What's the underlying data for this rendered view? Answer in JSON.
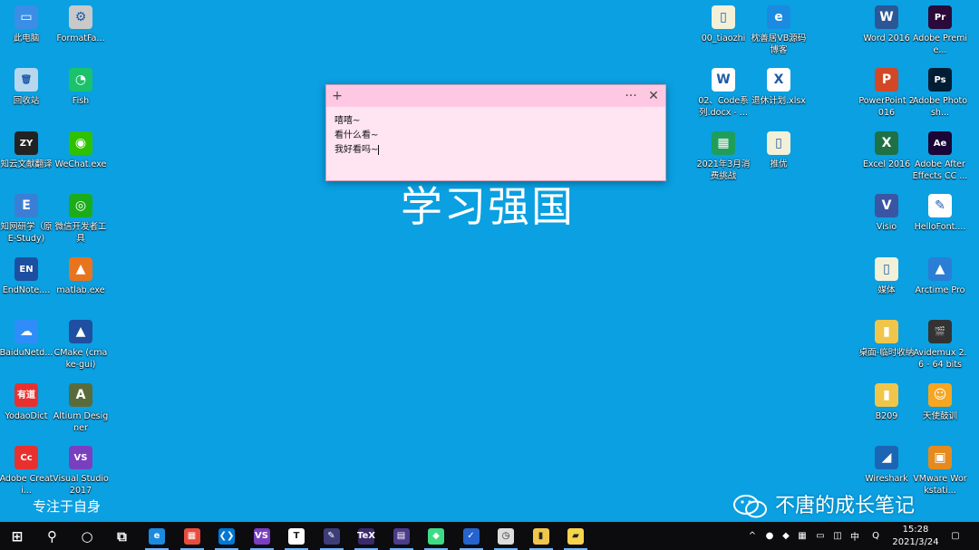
{
  "desktop": {
    "icons_left": [
      {
        "label": "此电脑",
        "icon": "computer-icon",
        "color": "#3a8ee6",
        "sym": "▭"
      },
      {
        "label": "FormatFa...",
        "icon": "formatfactory-icon",
        "color": "#c9c9c9",
        "sym": "⚙"
      },
      {
        "label": "回收站",
        "icon": "recycle-bin-icon",
        "color": "#b6d7ee",
        "sym": "🗑"
      },
      {
        "label": "Fish",
        "icon": "fish-icon",
        "color": "#19c26b",
        "sym": "◔"
      },
      {
        "label": "知云文献翻译",
        "icon": "zhiyun-icon",
        "color": "#222222",
        "sym": "ZY"
      },
      {
        "label": "WeChat.exe",
        "icon": "wechat-icon",
        "color": "#2dc100",
        "sym": "◉"
      },
      {
        "label": "知网研学（原E-Study)",
        "icon": "cnki-icon",
        "color": "#3a7fd5",
        "sym": "E"
      },
      {
        "label": "微信开发者工具",
        "icon": "wechat-devtools-icon",
        "color": "#1aad19",
        "sym": "◎"
      },
      {
        "label": "EndNote....",
        "icon": "endnote-icon",
        "color": "#1d4fa1",
        "sym": "EN"
      },
      {
        "label": "matlab.exe",
        "icon": "matlab-icon",
        "color": "#e8741e",
        "sym": "▲"
      },
      {
        "label": "BaiduNetd...",
        "icon": "baidu-netdisk-icon",
        "color": "#2f8dfa",
        "sym": "☁"
      },
      {
        "label": "CMake (cmake-gui)",
        "icon": "cmake-icon",
        "color": "#1e4fa0",
        "sym": "▲"
      },
      {
        "label": "YodaoDict",
        "icon": "youdao-icon",
        "color": "#e8312f",
        "sym": "有道"
      },
      {
        "label": "Altium Designer",
        "icon": "altium-icon",
        "color": "#5a6b3a",
        "sym": "A"
      },
      {
        "label": "Adobe Creati...",
        "icon": "creative-cloud-icon",
        "color": "#e8312f",
        "sym": "Cc"
      },
      {
        "label": "Visual Studio 2017",
        "icon": "visual-studio-icon",
        "color": "#7a3fbf",
        "sym": "VS"
      }
    ],
    "icons_right": [
      {
        "label": "00_tiaozhi",
        "icon": "file-icon",
        "color": "#f3f0d8",
        "sym": "▯"
      },
      {
        "label": "枕善居VB源码博客",
        "icon": "edge-icon",
        "color": "#1a8be0",
        "sym": "e"
      },
      {
        "label": "Word 2016",
        "icon": "word-icon",
        "color": "#2b5797",
        "sym": "W"
      },
      {
        "label": "Adobe Premie...",
        "icon": "premiere-icon",
        "color": "#2a0a3a",
        "sym": "Pr"
      },
      {
        "label": "02、Code系列.docx - ...",
        "icon": "docx-icon",
        "color": "#ffffff",
        "sym": "W"
      },
      {
        "label": "退休计划.xlsx",
        "icon": "xlsx-icon",
        "color": "#ffffff",
        "sym": "X"
      },
      {
        "label": "PowerPoint 2016",
        "icon": "powerpoint-icon",
        "color": "#d24726",
        "sym": "P"
      },
      {
        "label": "Adobe Photosh...",
        "icon": "photoshop-icon",
        "color": "#001d34",
        "sym": "Ps"
      },
      {
        "label": "2021年3月消费挑战",
        "icon": "sheet-icon",
        "color": "#1e9e5a",
        "sym": "▦"
      },
      {
        "label": "推优",
        "icon": "file-icon",
        "color": "#f3f0d8",
        "sym": "▯"
      },
      {
        "label": "Excel 2016",
        "icon": "excel-icon",
        "color": "#1e7145",
        "sym": "X"
      },
      {
        "label": "Adobe After Effects CC ...",
        "icon": "after-effects-icon",
        "color": "#1a0536",
        "sym": "Ae"
      },
      {
        "label": "Visio",
        "icon": "visio-icon",
        "color": "#3955a3",
        "sym": "V"
      },
      {
        "label": "HelloFont....",
        "icon": "hellofont-icon",
        "color": "#ffffff",
        "sym": "✎"
      },
      {
        "label": "媒体",
        "icon": "folder-media-icon",
        "color": "#f3f0d8",
        "sym": "▯"
      },
      {
        "label": "Arctime Pro",
        "icon": "arctime-icon",
        "color": "#2a7ed6",
        "sym": "▲"
      },
      {
        "label": "桌面-临时收纳",
        "icon": "folder-icon",
        "color": "#f0c64a",
        "sym": "▮"
      },
      {
        "label": "Avidemux 2.6 - 64 bits",
        "icon": "avidemux-icon",
        "color": "#333333",
        "sym": "🎬"
      },
      {
        "label": "B209",
        "icon": "folder-icon",
        "color": "#f0c64a",
        "sym": "▮"
      },
      {
        "label": "天使鼓训",
        "icon": "angel-icon",
        "color": "#f5a623",
        "sym": "☺"
      },
      {
        "label": "Wireshark",
        "icon": "wireshark-icon",
        "color": "#1c64b4",
        "sym": "◢"
      },
      {
        "label": "VMware Workstati...",
        "icon": "vmware-icon",
        "color": "#e58a1e",
        "sym": "▣"
      }
    ],
    "wallpaper_title": "学习强国",
    "wallpaper_caption": "专注于自身",
    "watermark": "不唐的成长笔记"
  },
  "sticky_note": {
    "lines": [
      "嘻嘻~",
      "看什么看~",
      "我好看吗~"
    ],
    "add_label": "+",
    "menu_label": "···",
    "close_label": "✕"
  },
  "taskbar": {
    "apps": [
      {
        "name": "start-button",
        "sym": "⊞",
        "color": "#0c0c0e"
      },
      {
        "name": "search-button",
        "sym": "⚲",
        "color": "#0c0c0e"
      },
      {
        "name": "cortana-button",
        "sym": "○",
        "color": "#0c0c0e"
      },
      {
        "name": "task-view-button",
        "sym": "⧉",
        "color": "#0c0c0e"
      },
      {
        "name": "taskbar-edge",
        "sym": "e",
        "color": "#1a8be0"
      },
      {
        "name": "taskbar-app-colorful",
        "sym": "▦",
        "color": "#e84c3d"
      },
      {
        "name": "taskbar-vscode",
        "sym": "❮❯",
        "color": "#0078d4"
      },
      {
        "name": "taskbar-visual-studio",
        "sym": "VS",
        "color": "#7a3fbf"
      },
      {
        "name": "taskbar-typora",
        "sym": "T",
        "color": "#ffffff"
      },
      {
        "name": "taskbar-app-pen",
        "sym": "✎",
        "color": "#3d3d7a"
      },
      {
        "name": "taskbar-tex",
        "sym": "TeX",
        "color": "#3b2a6b"
      },
      {
        "name": "taskbar-app-bar",
        "sym": "▤",
        "color": "#4b3b8a"
      },
      {
        "name": "taskbar-android",
        "sym": "◆",
        "color": "#3ddc84"
      },
      {
        "name": "taskbar-todo",
        "sym": "✓",
        "color": "#2564cf"
      },
      {
        "name": "taskbar-clock-app",
        "sym": "◷",
        "color": "#dddddd"
      },
      {
        "name": "taskbar-file-explorer",
        "sym": "▮",
        "color": "#f0c64a"
      },
      {
        "name": "taskbar-sticky-notes",
        "sym": "▰",
        "color": "#f7d44c"
      }
    ],
    "tray": {
      "chevron": "^",
      "ime": "中",
      "time": "15:28",
      "date": "2021/3/24"
    }
  }
}
